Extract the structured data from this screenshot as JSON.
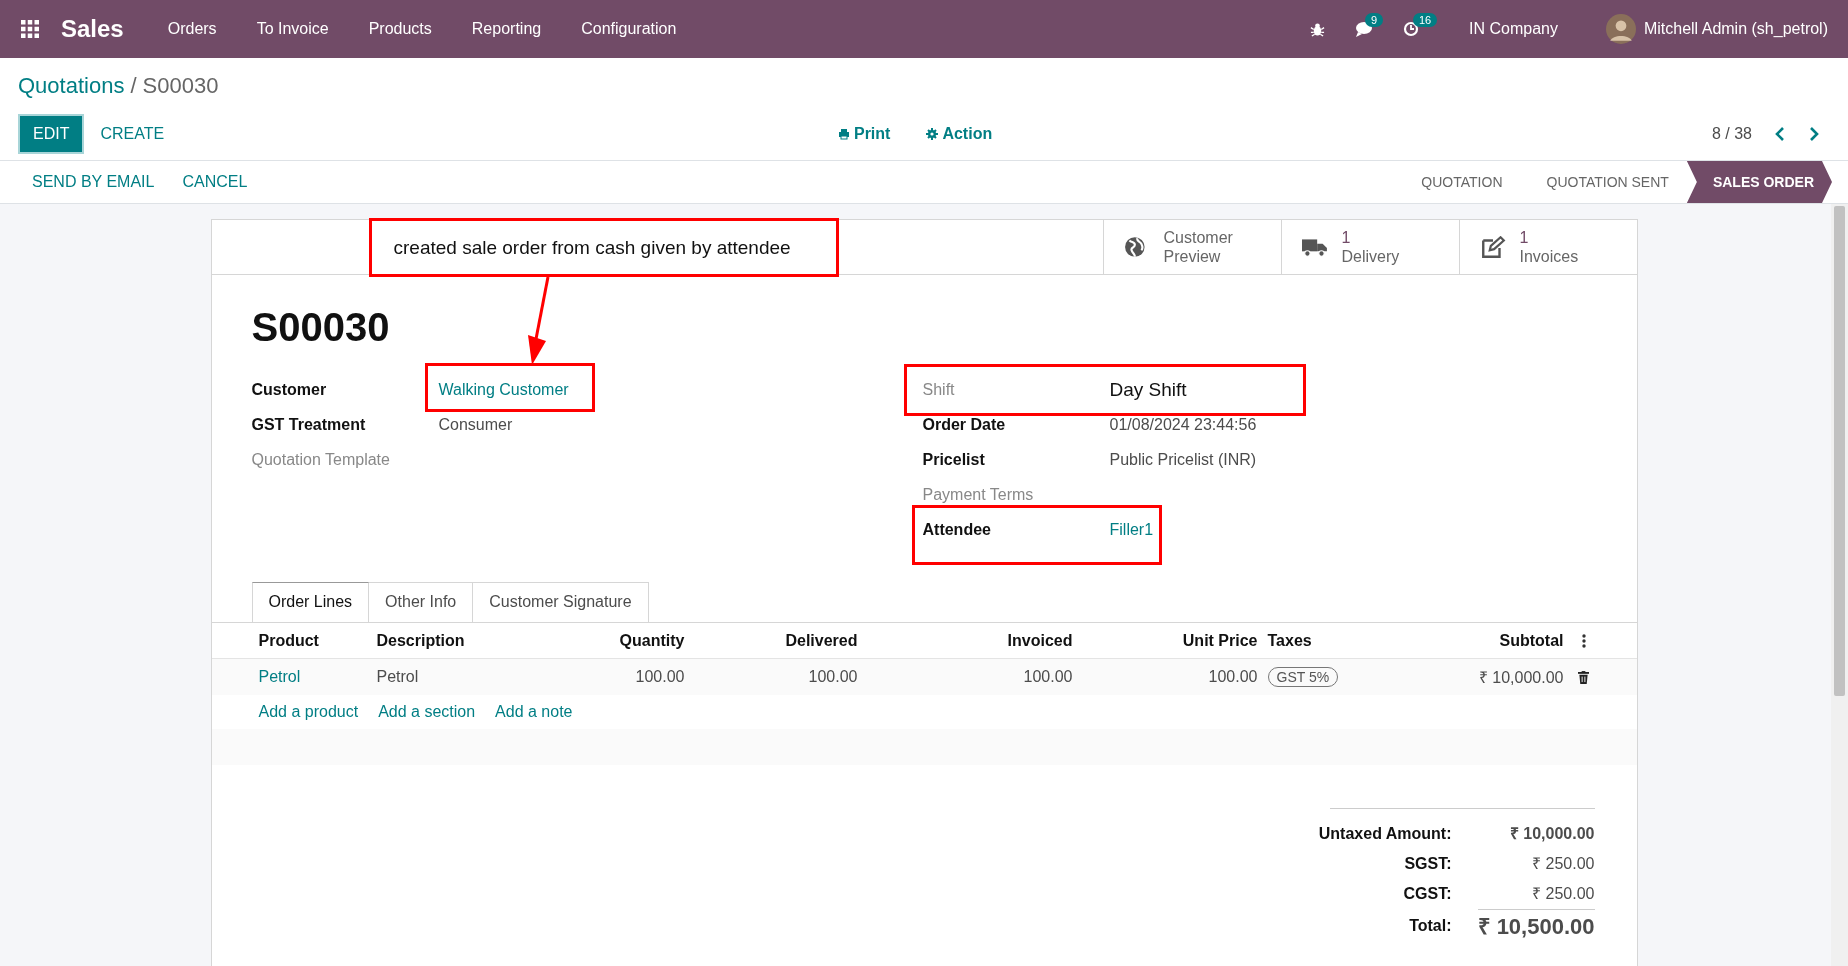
{
  "navbar": {
    "app": "Sales",
    "menu": [
      "Orders",
      "To Invoice",
      "Products",
      "Reporting",
      "Configuration"
    ],
    "messages_count": "9",
    "activities_count": "16",
    "company": "IN Company",
    "user": "Mitchell Admin (sh_petrol)"
  },
  "breadcrumb": {
    "parent": "Quotations",
    "separator": "/",
    "current": "S00030"
  },
  "toolbar": {
    "buttons": [
      {
        "label": "EDIT",
        "primary": true
      },
      {
        "label": "CREATE",
        "primary": false
      }
    ],
    "print": "Print",
    "action": "Action",
    "pager": "8 / 38"
  },
  "header": {
    "buttons": [
      "SEND BY EMAIL",
      "CANCEL"
    ],
    "stages": [
      {
        "label": "QUOTATION",
        "selected": false
      },
      {
        "label": "QUOTATION SENT",
        "selected": false
      },
      {
        "label": "SALES ORDER",
        "selected": true
      }
    ]
  },
  "stat_buttons": [
    {
      "kind": "globe",
      "label": "Customer Preview"
    },
    {
      "kind": "truck",
      "count": "1",
      "label": "Delivery"
    },
    {
      "kind": "edit",
      "count": "1",
      "label": "Invoices"
    }
  ],
  "annotation": {
    "text": "created sale order from cash given by attendee"
  },
  "title": "S00030",
  "fields_left": [
    {
      "label": "Customer",
      "value": "Walking Customer",
      "muted": false,
      "link": true,
      "highlighted": true
    },
    {
      "label": "GST Treatment",
      "value": "Consumer",
      "muted": false,
      "link": false,
      "highlighted": false
    },
    {
      "label": "Quotation Template",
      "muted": true,
      "highlighted": false
    }
  ],
  "fields_right": [
    {
      "label": "Shift",
      "value": "Day Shift",
      "muted": true,
      "link": false,
      "highlighted": true
    },
    {
      "label": "Order Date",
      "value": "01/08/2024 23:44:56",
      "muted": false,
      "link": false,
      "highlighted": false
    },
    {
      "label": "Pricelist",
      "value": "Public Pricelist (INR)",
      "muted": false,
      "link": false,
      "highlighted": false
    },
    {
      "label": "Payment Terms",
      "muted": true,
      "highlighted": false
    },
    {
      "label": "Attendee",
      "value": "Filler1",
      "muted": false,
      "link": true,
      "highlighted": true
    }
  ],
  "tabs": [
    {
      "label": "Order Lines",
      "selected": true
    },
    {
      "label": "Other Info",
      "selected": false
    },
    {
      "label": "Customer Signature",
      "selected": false
    }
  ],
  "table": {
    "columns": [
      "Product",
      "Description",
      "Quantity",
      "Delivered",
      "Invoiced",
      "Unit Price",
      "Taxes",
      "Subtotal"
    ],
    "rows": [
      {
        "cells": [
          "Petrol",
          "Petrol",
          "100.00",
          "100.00",
          "100.00",
          "100.00",
          "GST 5%",
          "₹ 10,000.00"
        ]
      }
    ],
    "add_links": [
      "Add a product",
      "Add a section",
      "Add a note"
    ]
  },
  "totals": [
    {
      "kind": "untaxed",
      "label": "Untaxed Amount:",
      "value": "₹ 10,000.00"
    },
    {
      "kind": "tax",
      "label": "SGST:",
      "value": "₹ 250.00"
    },
    {
      "kind": "tax",
      "label": "CGST:",
      "value": "₹ 250.00"
    },
    {
      "kind": "total",
      "label": "Total:",
      "value": "₹ 10,500.00"
    }
  ]
}
